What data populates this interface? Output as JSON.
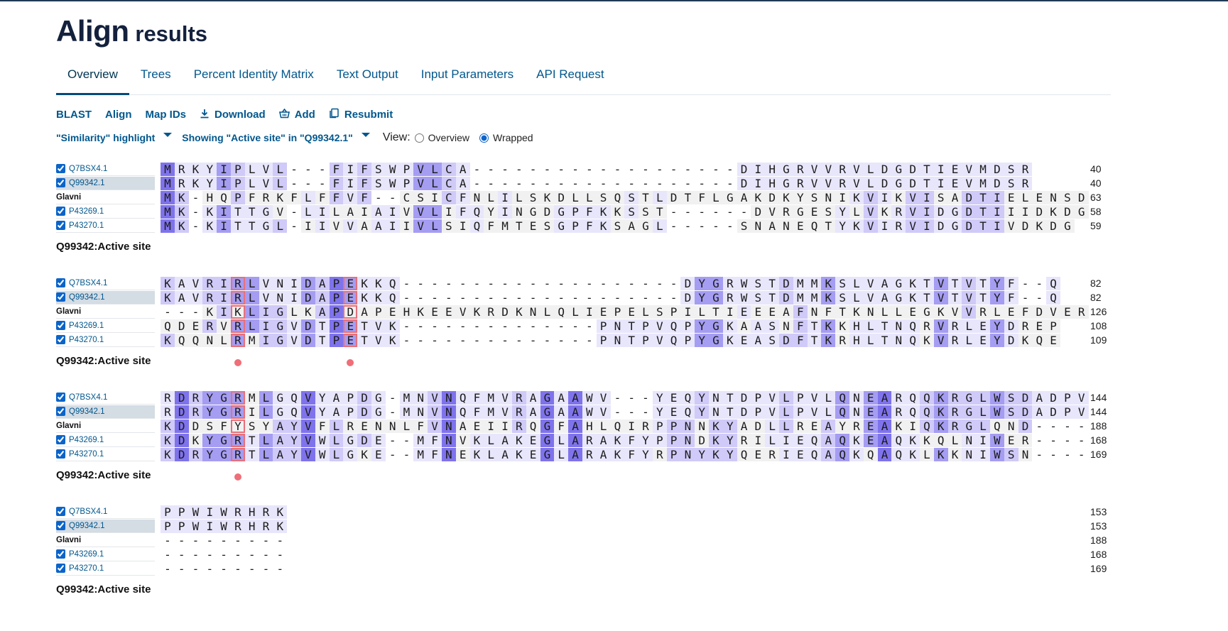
{
  "header": {
    "title_main": "Align",
    "title_sub": "results"
  },
  "tabs": [
    {
      "label": "Overview",
      "active": true
    },
    {
      "label": "Trees",
      "active": false
    },
    {
      "label": "Percent Identity Matrix",
      "active": false
    },
    {
      "label": "Text Output",
      "active": false
    },
    {
      "label": "Input Parameters",
      "active": false
    },
    {
      "label": "API Request",
      "active": false
    }
  ],
  "actions": [
    {
      "label": "BLAST",
      "icon": ""
    },
    {
      "label": "Align",
      "icon": ""
    },
    {
      "label": "Map IDs",
      "icon": ""
    },
    {
      "label": "Download",
      "icon": "download-icon"
    },
    {
      "label": "Add",
      "icon": "basket-icon"
    },
    {
      "label": "Resubmit",
      "icon": "resubmit-icon"
    }
  ],
  "controls": {
    "highlight_label": "\"Similarity\" highlight",
    "showing_label": "Showing \"Active site\" in \"Q99342.1\"",
    "view_label": "View:",
    "view_options": [
      {
        "label": "Overview",
        "checked": false
      },
      {
        "label": "Wrapped",
        "checked": true
      }
    ]
  },
  "colors": {
    "accent": "#01578d",
    "active_site_marker": "#ee6f78",
    "similarity_strong": "#7f73ec",
    "similarity_medium": "#a59df2",
    "similarity_light": "#cfcaf8",
    "similarity_faint": "#e8e6fb"
  },
  "feature_label": "Q99342:Active site",
  "sequences": [
    {
      "id": "Q7BSX4.1",
      "checked": true,
      "selected": false
    },
    {
      "id": "Q99342.1",
      "checked": true,
      "selected": true
    },
    {
      "id": "Glavni",
      "checked": false,
      "selected": false,
      "reference": true
    },
    {
      "id": "P43269.1",
      "checked": true,
      "selected": false
    },
    {
      "id": "P43270.1",
      "checked": true,
      "selected": false
    }
  ],
  "blocks": [
    {
      "rows": [
        "MRKYIPLVL---FIFSWPVLCA-------------------DIHGRVVRVLDGDTIEVMDSR",
        "MRKYIPLVL---FIFSWPVLCA-------------------DIHGRVVRVLDGDTIEVMDSR",
        "MK-HQPFRKFLFFVF--CSICFNLILSKDLLSQSTLDTFLGAKDKYSNIKVIKVISADTIELENSD",
        "MK-KITTGV-LILAIAIVVLIFQYINGDGPFKKSST------DVRGESYLVKRVIDGDTIIIDKDG",
        "MK-KITTGL-IIVVAAIIVLSIQFMTESGPFKSAGL-----SNANEQTYKVIRVIDGDTIVDKDG"
      ],
      "ends": [
        "40",
        "40",
        "63",
        "58",
        "59"
      ],
      "markers": []
    },
    {
      "rows": [
        "KAVRIRLVNIDAPEKKQ--------------------DYGRWSTDMMKSLVAGKTVTVTYF--Q",
        "KAVRIRLVNIDAPEKKQ--------------------DYGRWSTDMMKSLVAGKTVTVTYF--Q",
        "---KIKLIGLKAPDAPEHKEEVKRDKNLQLIEPELSPILTIEEEAFNFTKNLLEGKVVRLEFDVER",
        "QDERVRLIGVDTPETVK--------------PNTPVQPYGKAASNFTKKHLTNQRVRLEYDREP",
        "KQQNLRMIGVDTPETVK--------------PNTPVQPYGKEASDFTKRHLTNQKVRLEYDKQE"
      ],
      "ends": [
        "82",
        "82",
        "126",
        "108",
        "109"
      ],
      "markers": [
        5,
        13
      ]
    },
    {
      "rows": [
        "RDRYGRMLGQVYAPDG-MNVNQFMVRAGAAWV---YEQYNTDPVLPVLQNEARQQKRGLWSDADPV",
        "RDRYGRILGQVYAPDG-MNVNQFMVRAGAAWV---YEQYNTDPVLPVLQNEARQQKRGLWSDADPV",
        "KDDSFYSYAYVFLRENNLFVNAEIIRQGFAHLQIRPPNNKYADLLREAYREAKIQKRGLQND----",
        "KDKYGRTLAYVWLGDE--MFNVKLAKEGLARAKFYPPNDKYRILIEQAQKEAQKKQLNIWER----",
        "KDRYGRTLAYVWLGKE--MFNEKLAKEGLARAKFYRPNYKYQERIEQAQKQAQKLKKNIWSN----"
      ],
      "ends": [
        "144",
        "144",
        "188",
        "168",
        "169"
      ],
      "markers": [
        5
      ]
    },
    {
      "rows": [
        "PPWIWRHRK",
        "PPWIWRHRK",
        "---------",
        "---------",
        "---------"
      ],
      "ends": [
        "153",
        "153",
        "188",
        "168",
        "169"
      ],
      "markers": []
    }
  ]
}
